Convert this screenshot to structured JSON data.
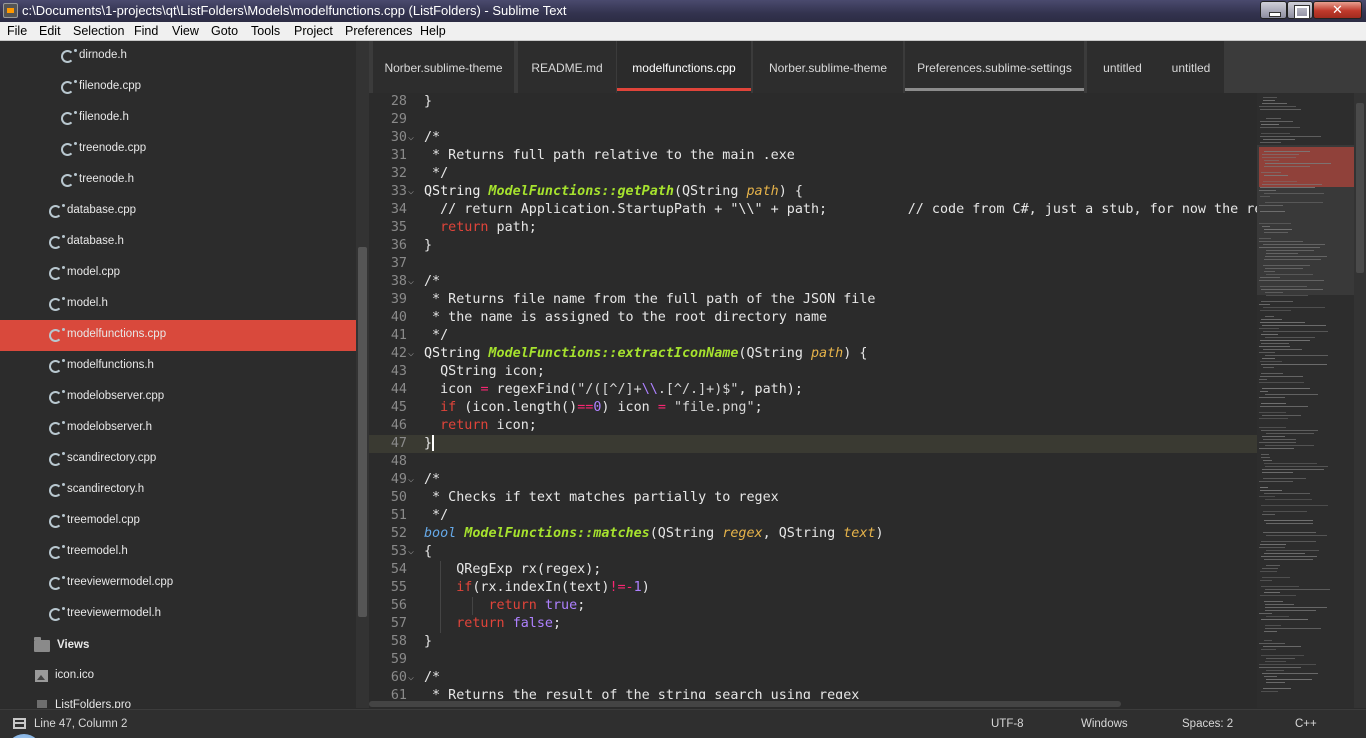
{
  "window": {
    "title": "c:\\Documents\\1-projects\\qt\\ListFolders\\Models\\modelfunctions.cpp (ListFolders) - Sublime Text"
  },
  "menu": [
    "File",
    "Edit",
    "Selection",
    "Find",
    "View",
    "Goto",
    "Tools",
    "Project",
    "Preferences",
    "Help"
  ],
  "sidebar": {
    "items": [
      {
        "label": "dirnode.h",
        "icon": "c-file-icon"
      },
      {
        "label": "filenode.cpp",
        "icon": "c-file-icon"
      },
      {
        "label": "filenode.h",
        "icon": "c-file-icon"
      },
      {
        "label": "treenode.cpp",
        "icon": "c-file-icon"
      },
      {
        "label": "treenode.h",
        "icon": "c-file-icon"
      },
      {
        "label": "database.cpp",
        "icon": "c-file-icon"
      },
      {
        "label": "database.h",
        "icon": "c-file-icon"
      },
      {
        "label": "model.cpp",
        "icon": "c-file-icon"
      },
      {
        "label": "model.h",
        "icon": "c-file-icon"
      },
      {
        "label": "modelfunctions.cpp",
        "icon": "c-file-icon",
        "selected": true
      },
      {
        "label": "modelfunctions.h",
        "icon": "c-file-icon"
      },
      {
        "label": "modelobserver.cpp",
        "icon": "c-file-icon"
      },
      {
        "label": "modelobserver.h",
        "icon": "c-file-icon"
      },
      {
        "label": "scandirectory.cpp",
        "icon": "c-file-icon"
      },
      {
        "label": "scandirectory.h",
        "icon": "c-file-icon"
      },
      {
        "label": "treemodel.cpp",
        "icon": "c-file-icon"
      },
      {
        "label": "treemodel.h",
        "icon": "c-file-icon"
      },
      {
        "label": "treeviewermodel.cpp",
        "icon": "c-file-icon"
      },
      {
        "label": "treeviewermodel.h",
        "icon": "c-file-icon"
      },
      {
        "label": "Views",
        "icon": "folder-icon"
      },
      {
        "label": "icon.ico",
        "icon": "image-file-icon"
      },
      {
        "label": "ListFolders.pro",
        "icon": "project-file-icon"
      }
    ]
  },
  "tabs": [
    {
      "label": "Norber.sublime-theme"
    },
    {
      "label": "README.md"
    },
    {
      "label": "modelfunctions.cpp",
      "active": true
    },
    {
      "label": "Norber.sublime-theme"
    },
    {
      "label": "Preferences.sublime-settings",
      "modified": true
    },
    {
      "label": "untitled"
    },
    {
      "label": "untitled"
    }
  ],
  "editor": {
    "lines": [
      {
        "n": "28",
        "text": "}"
      },
      {
        "n": "29",
        "text": ""
      },
      {
        "n": "30",
        "text": "/*"
      },
      {
        "n": "31",
        "text": " * Returns full path relative to the main .exe"
      },
      {
        "n": "32",
        "text": " */"
      },
      {
        "n": "33",
        "text": "QString ModelFunctions::getPath(QString path) {"
      },
      {
        "n": "34",
        "text": "  // return Application.StartupPath + \"\\\\\" + path;          // code from C#, just a stub, for now the re"
      },
      {
        "n": "35",
        "text": "  return path;"
      },
      {
        "n": "36",
        "text": "}"
      },
      {
        "n": "37",
        "text": ""
      },
      {
        "n": "38",
        "text": "/*"
      },
      {
        "n": "39",
        "text": " * Returns file name from the full path of the JSON file"
      },
      {
        "n": "40",
        "text": " * the name is assigned to the root directory name"
      },
      {
        "n": "41",
        "text": " */"
      },
      {
        "n": "42",
        "text": "QString ModelFunctions::extractIconName(QString path) {"
      },
      {
        "n": "43",
        "text": "  QString icon;"
      },
      {
        "n": "44",
        "text": "  icon = regexFind(\"/([^/]+\\\\.[^/.]+)$\", path);"
      },
      {
        "n": "45",
        "text": "  if (icon.length()==0) icon = \"file.png\";"
      },
      {
        "n": "46",
        "text": "  return icon;"
      },
      {
        "n": "47",
        "text": "}"
      },
      {
        "n": "48",
        "text": ""
      },
      {
        "n": "49",
        "text": "/*"
      },
      {
        "n": "50",
        "text": " * Checks if text matches partially to regex"
      },
      {
        "n": "51",
        "text": " */"
      },
      {
        "n": "52",
        "text": "bool ModelFunctions::matches(QString regex, QString text)"
      },
      {
        "n": "53",
        "text": "{"
      },
      {
        "n": "54",
        "text": "    QRegExp rx(regex);"
      },
      {
        "n": "55",
        "text": "    if(rx.indexIn(text)!=-1)"
      },
      {
        "n": "56",
        "text": "        return true;"
      },
      {
        "n": "57",
        "text": "    return false;"
      },
      {
        "n": "58",
        "text": "}"
      },
      {
        "n": "59",
        "text": ""
      },
      {
        "n": "60",
        "text": "/*"
      },
      {
        "n": "61",
        "text": " * Returns the result of the string search using regex"
      }
    ]
  },
  "status": {
    "position": "Line 47, Column 2",
    "encoding": "UTF-8",
    "line_endings": "Windows",
    "indent": "Spaces: 2",
    "syntax": "C++"
  },
  "colors": {
    "accent": "#d9493c",
    "keyword": "#e0443a",
    "function": "#a6e22e",
    "param": "#e6b34a"
  }
}
